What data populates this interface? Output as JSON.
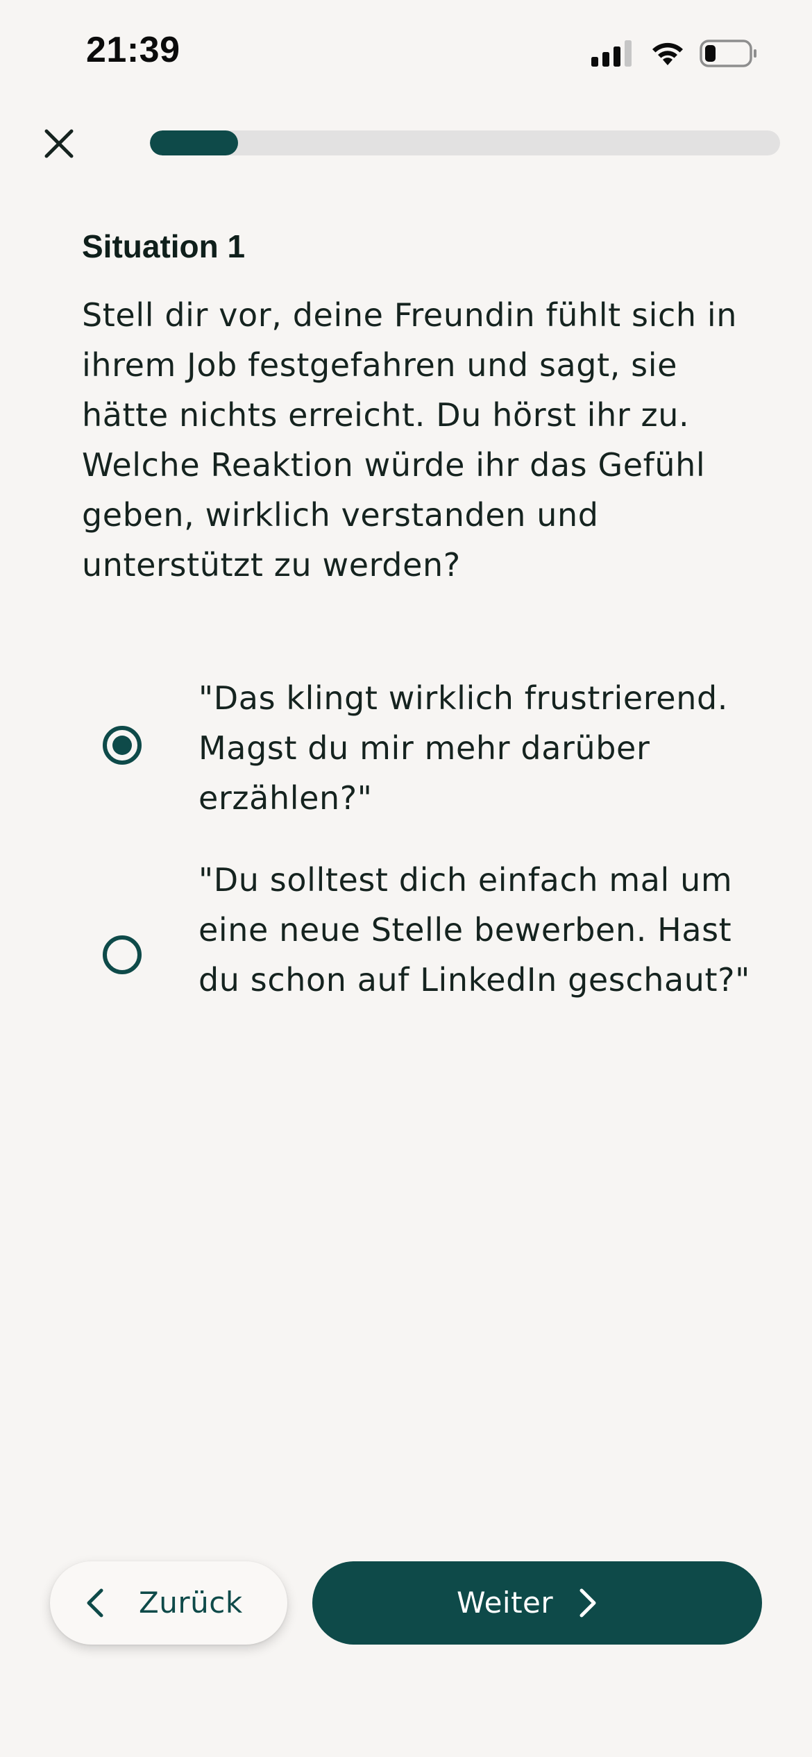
{
  "status_bar": {
    "time": "21:39",
    "signal_icon": "cellular-signal-icon",
    "wifi_icon": "wifi-icon",
    "battery_icon": "battery-icon",
    "battery_level": 0.25
  },
  "nav": {
    "close_icon": "close-icon",
    "progress_fraction": 0.14,
    "progress_color": "#0e4a49",
    "track_color": "#e2e1e1"
  },
  "content": {
    "title": "Situation 1",
    "question": "Stell dir vor, deine Freundin fühlt sich in ihrem Job festgefahren und sagt, sie hätte nichts erreicht. Du hörst ihr zu. Welche Reaktion würde ihr das Gefühl geben, wirklich verstanden und unterstützt zu werden?",
    "options": [
      {
        "text": "\"Das klingt wirklich frustrierend. Magst du mir mehr darüber erzählen?\"",
        "selected": true
      },
      {
        "text": "\"Du solltest dich einfach mal um eine neue Stelle bewerben. Hast du schon auf LinkedIn geschaut?\"",
        "selected": false
      }
    ]
  },
  "footer": {
    "back_label": "Zurück",
    "back_icon": "chevron-left-icon",
    "next_label": "Weiter",
    "next_icon": "chevron-right-icon"
  },
  "colors": {
    "accent": "#0e4a49",
    "background": "#f7f5f3",
    "text": "#15231f"
  }
}
